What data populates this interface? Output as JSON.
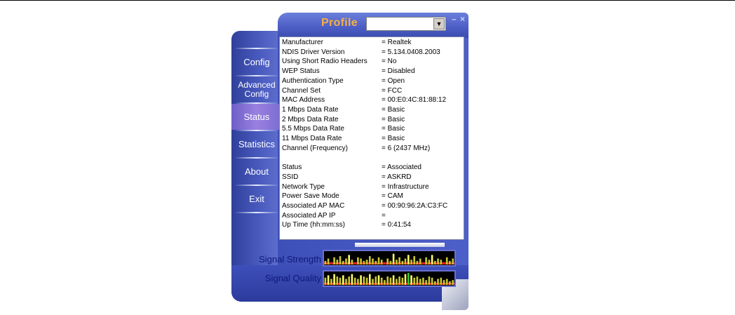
{
  "window": {
    "title": "Profile",
    "profile_value": "",
    "minimize_glyph": "–",
    "close_glyph": "×"
  },
  "nav": [
    {
      "label": "Config",
      "active": false
    },
    {
      "label": "Advanced\nConfig",
      "active": false
    },
    {
      "label": "Status",
      "active": true
    },
    {
      "label": "Statistics",
      "active": false
    },
    {
      "label": "About",
      "active": false
    },
    {
      "label": "Exit",
      "active": false
    }
  ],
  "info": [
    {
      "key": "Manufacturer",
      "value": "= Realtek"
    },
    {
      "key": "NDIS Driver Version",
      "value": "= 5.134.0408.2003"
    },
    {
      "key": "Using Short Radio Headers",
      "value": "= No"
    },
    {
      "key": "WEP Status",
      "value": "= Disabled"
    },
    {
      "key": "Authentication Type",
      "value": "= Open"
    },
    {
      "key": "Channel Set",
      "value": "= FCC"
    },
    {
      "key": "MAC Address",
      "value": "= 00:E0:4C:81:88:12"
    },
    {
      "key": "1 Mbps Data Rate",
      "value": "= Basic"
    },
    {
      "key": "2 Mbps Data Rate",
      "value": "= Basic"
    },
    {
      "key": "5.5 Mbps Data Rate",
      "value": "= Basic"
    },
    {
      "key": "11 Mbps Data Rate",
      "value": "= Basic"
    },
    {
      "key": "Channel (Frequency)",
      "value": "= 6 (2437 MHz)"
    },
    {
      "key": "",
      "value": ""
    },
    {
      "key": "Status",
      "value": "= Associated"
    },
    {
      "key": "SSID",
      "value": "= ASKRD"
    },
    {
      "key": "Network Type",
      "value": "= Infrastructure"
    },
    {
      "key": "Power Save Mode",
      "value": "= CAM"
    },
    {
      "key": "Associated AP MAC",
      "value": "= 00:90:96:2A:C3:FC"
    },
    {
      "key": "Associated AP IP",
      "value": "="
    },
    {
      "key": "Up Time (hh:mm:ss)",
      "value": "= 0:41:54"
    }
  ],
  "signal": {
    "strength_label": "Signal Strength",
    "quality_label": "Signal Quality",
    "strength_bars": [
      0.3,
      0.5,
      0.2,
      0.6,
      0.4,
      0.7,
      0.3,
      0.5,
      0.8,
      0.4,
      0.2,
      0.6,
      0.5,
      0.3,
      0.4,
      0.7,
      0.5,
      0.3,
      0.6,
      0.4,
      0.2,
      0.5,
      0.3,
      0.9,
      0.4,
      0.6,
      0.3,
      0.5,
      0.8,
      0.4,
      0.7,
      0.3,
      0.5,
      0.2,
      0.6,
      0.4,
      0.8,
      0.3,
      0.5,
      0.4,
      0.2,
      0.6,
      0.3,
      0.5
    ],
    "quality_bars": [
      0.6,
      0.8,
      0.5,
      0.9,
      0.7,
      0.6,
      0.8,
      0.5,
      0.7,
      0.9,
      0.6,
      0.5,
      0.8,
      0.7,
      0.6,
      0.9,
      0.5,
      0.7,
      0.8,
      0.6,
      0.4,
      0.7,
      0.6,
      0.8,
      0.5,
      0.7,
      0.6,
      0.9,
      1.0,
      0.8,
      0.6,
      0.7,
      0.5,
      0.6,
      0.4,
      0.7,
      0.6,
      0.3,
      0.5,
      0.6,
      0.4,
      0.5,
      0.3,
      0.4
    ],
    "colors": {
      "high": "#ffff66",
      "mid": "#c8c832",
      "low": "#e02020",
      "peak": "#33cc33",
      "bg": "#000000"
    }
  }
}
